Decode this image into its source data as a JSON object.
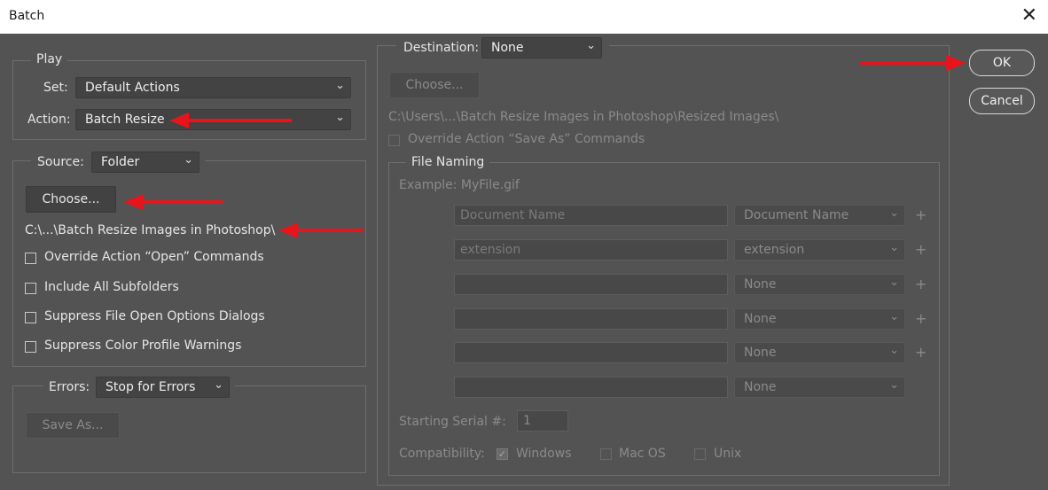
{
  "window": {
    "title": "Batch",
    "close_glyph": "✕"
  },
  "play": {
    "legend": "Play",
    "set_label": "Set:",
    "set_value": "Default Actions",
    "action_label": "Action:",
    "action_value": "Batch Resize"
  },
  "source": {
    "label": "Source:",
    "value": "Folder",
    "choose_button": "Choose...",
    "path": "C:\\...\\Batch Resize Images in Photoshop\\",
    "options": [
      "Override Action “Open” Commands",
      "Include All Subfolders",
      "Suppress File Open Options Dialogs",
      "Suppress Color Profile Warnings"
    ]
  },
  "errors": {
    "label": "Errors:",
    "value": "Stop for Errors",
    "save_as_button": "Save As..."
  },
  "destination": {
    "label": "Destination:",
    "value": "None",
    "choose_button": "Choose...",
    "path": "C:\\Users\\...\\Batch Resize Images in Photoshop\\Resized Images\\",
    "override_label": "Override Action “Save As” Commands"
  },
  "file_naming": {
    "legend": "File Naming",
    "example": "Example: MyFile.gif",
    "rows": [
      {
        "field": "Document Name",
        "select": "Document Name",
        "plus": "+"
      },
      {
        "field": "extension",
        "select": "extension",
        "plus": "+"
      },
      {
        "field": "",
        "select": "None",
        "plus": "+"
      },
      {
        "field": "",
        "select": "None",
        "plus": "+"
      },
      {
        "field": "",
        "select": "None",
        "plus": "+"
      },
      {
        "field": "",
        "select": "None",
        "plus": ""
      }
    ],
    "serial_label": "Starting Serial #:",
    "serial_value": "1",
    "compat_label": "Compatibility:",
    "compat_options": [
      {
        "label": "Windows",
        "checked": true
      },
      {
        "label": "Mac OS",
        "checked": false
      },
      {
        "label": "Unix",
        "checked": false
      }
    ]
  },
  "buttons": {
    "ok": "OK",
    "cancel": "Cancel"
  },
  "colors": {
    "background": "#535353",
    "annotation_arrow": "#e8141b"
  },
  "icons": {
    "dropdown": "chevron-down-icon",
    "checkmark": "checkmark-icon"
  }
}
